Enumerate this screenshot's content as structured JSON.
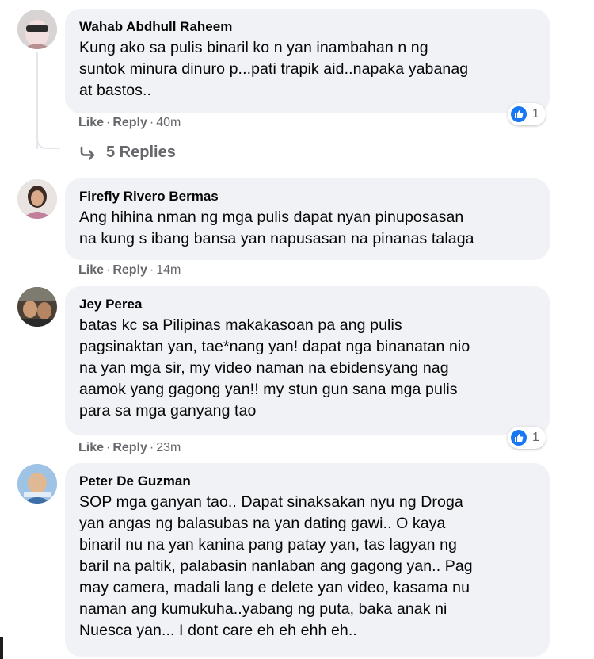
{
  "comments": [
    {
      "author": "Wahab Abdhull Raheem",
      "text": "Kung ako sa pulis binaril ko n yan inambahan n ng\nsuntok minura dinuro p...pati trapik aid..napaka yabanag\nat bastos..",
      "like": "Like",
      "reply": "Reply",
      "time": "40m",
      "reactions": "1"
    },
    {
      "author": "Firefly Rivero Bermas",
      "text": "Ang hihina nman ng mga pulis dapat nyan pinuposasan\nna kung s ibang bansa yan napusasan na pinanas talaga",
      "like": "Like",
      "reply": "Reply",
      "time": "14m"
    },
    {
      "author": "Jey Perea",
      "text": "batas kc sa Pilipinas makakasoan pa ang pulis\npagsinaktan yan, tae*nang yan! dapat nga binanatan nio\nna yan mga sir, my video naman na ebidensyang nag\naamok yang gagong yan!! my stun gun sana mga pulis\npara sa mga ganyang tao",
      "like": "Like",
      "reply": "Reply",
      "time": "23m",
      "reactions": "1"
    },
    {
      "author": "Peter De Guzman",
      "text": "SOP mga ganyan tao.. Dapat sinaksakan nyu ng Droga\nyan angas ng balasubas na yan dating gawi.. O kaya\nbinaril nu na yan kanina pang patay yan, tas lagyan ng\nbaril na paltik, palabasin nanlaban ang gagong yan.. Pag\nmay camera, madali lang e delete yan video, kasama nu\nnaman ang kumukuha..yabang ng puta, baka anak ni\nNuesca yan... I dont care eh eh ehh eh.."
    }
  ],
  "replies_label": "5 Replies",
  "colors": {
    "bubble": "#f0f2f5",
    "meta": "#65676b",
    "like_blue": "#1877f2"
  }
}
